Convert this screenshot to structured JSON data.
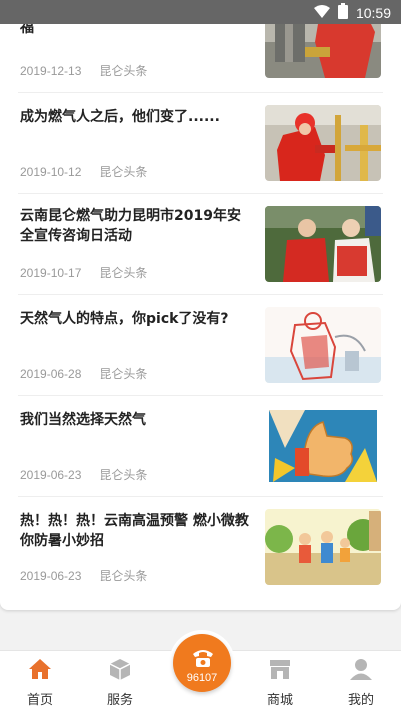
{
  "status_bar": {
    "time": "10:59"
  },
  "news": [
    {
      "title": "福",
      "date": "2019-12-13",
      "source": "昆仑头条",
      "thumb": "gas-worker-red"
    },
    {
      "title": "成为燃气人之后，他们变了......",
      "date": "2019-10-12",
      "source": "昆仑头条",
      "thumb": "worker-pipes"
    },
    {
      "title": "云南昆仑燃气助力昆明市2019年安全宣传咨询日活动",
      "date": "2019-10-17",
      "source": "昆仑头条",
      "thumb": "campaign-event"
    },
    {
      "title": "天然气人的特点，你pick了没有?",
      "date": "2019-06-28",
      "source": "昆仑头条",
      "thumb": "sketch-worker"
    },
    {
      "title": "我们当然选择天然气",
      "date": "2019-06-23",
      "source": "昆仑头条",
      "thumb": "thumbs-up"
    },
    {
      "title": "热！热！热！云南高温预警 燃小微教你防暑小妙招",
      "date": "2019-06-23",
      "source": "昆仑头条",
      "thumb": "cartoon-family"
    }
  ],
  "tab_bar": {
    "home": "首页",
    "service": "服务",
    "hotline": "96107",
    "mall": "商城",
    "mine": "我的"
  },
  "colors": {
    "accent": "#f07a1e",
    "home_icon": "#e8712c",
    "inactive_icon": "#b5b5b5"
  }
}
